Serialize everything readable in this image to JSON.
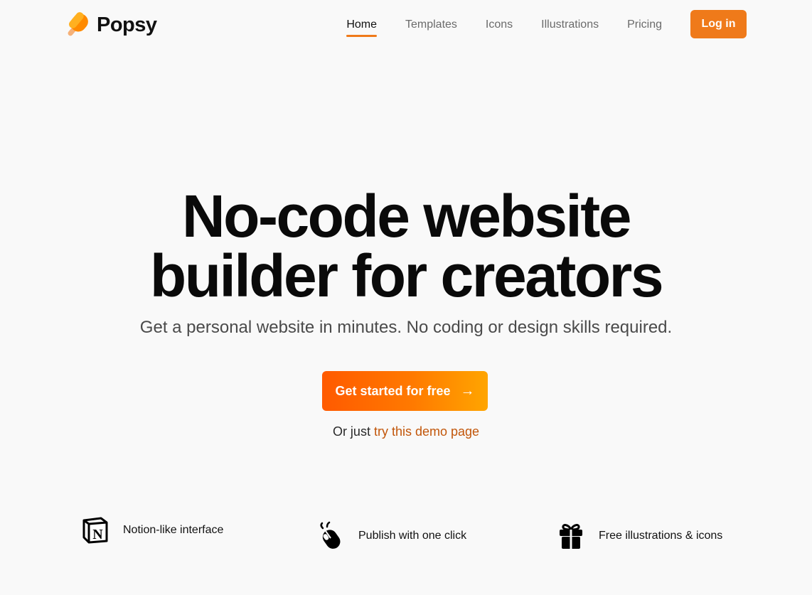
{
  "brand": {
    "name": "Popsy",
    "colors": {
      "accent": "#ef7a1a",
      "cta_start": "#ff5a00",
      "cta_end": "#ffa500",
      "link": "#c2560a"
    }
  },
  "nav": {
    "items": [
      {
        "label": "Home",
        "active": true
      },
      {
        "label": "Templates",
        "active": false
      },
      {
        "label": "Icons",
        "active": false
      },
      {
        "label": "Illustrations",
        "active": false
      },
      {
        "label": "Pricing",
        "active": false
      }
    ],
    "login_label": "Log in"
  },
  "hero": {
    "title_line1": "No-code website",
    "title_line2": "builder for creators",
    "subtitle": "Get a personal website in minutes. No coding or design skills required.",
    "cta_label": "Get started for free",
    "cta_icon": "arrow-right-icon",
    "demo_prefix": "Or just",
    "demo_link": "try this demo page"
  },
  "features": [
    {
      "icon": "notion-icon",
      "label": "Notion-like interface"
    },
    {
      "icon": "mouse-click-icon",
      "label": "Publish with one click"
    },
    {
      "icon": "gift-icon",
      "label": "Free illustrations & icons"
    }
  ]
}
